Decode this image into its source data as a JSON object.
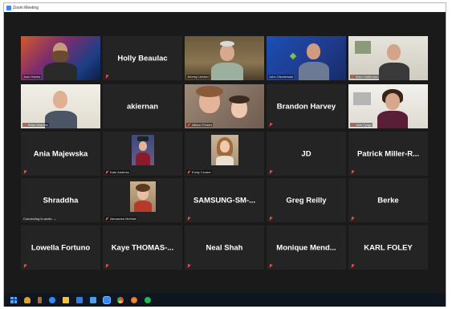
{
  "window": {
    "title": "Zoom Meeting"
  },
  "colors": {
    "tile_bg": "#242424",
    "active_border": "#c8d84a",
    "mute_red": "#e8534a",
    "taskbar": "#0f1620"
  },
  "participants": [
    {
      "name_label": "Josh Heehs",
      "display": "video",
      "muted": false
    },
    {
      "name_label": "Holly Beaulac",
      "display": "name",
      "muted": true
    },
    {
      "name_label": "Jeremy Uecker",
      "display": "video",
      "muted": false,
      "active_speaker": true
    },
    {
      "name_label": "John Olschewski",
      "display": "video",
      "muted": false
    },
    {
      "name_label": "Marc Halferman",
      "display": "video",
      "muted": true
    },
    {
      "name_label": "Brian Marples",
      "display": "video",
      "muted": true
    },
    {
      "name_label": "akiernan",
      "display": "name",
      "muted": false
    },
    {
      "name_label": "Allison Fricker",
      "display": "video",
      "muted": true
    },
    {
      "name_label": "Brandon Harvey",
      "display": "name",
      "muted": true
    },
    {
      "name_label": "Julie Fydge",
      "display": "video",
      "muted": true
    },
    {
      "name_label": "Ania Majewska",
      "display": "name",
      "muted": true
    },
    {
      "name_label": "Kate Anderss",
      "display": "photo",
      "muted": true
    },
    {
      "name_label": "Emily Crosier",
      "display": "photo",
      "muted": true
    },
    {
      "name_label": "JD",
      "display": "name",
      "muted": true
    },
    {
      "name_label": "Patrick Miller-R...",
      "display": "name",
      "muted": true
    },
    {
      "name_label": "Shraddha",
      "display": "name",
      "muted": false,
      "status": "Connecting to audio"
    },
    {
      "name_label": "Alexandra McHale",
      "display": "photo",
      "muted": true
    },
    {
      "name_label": "SAMSUNG-SM-...",
      "display": "name",
      "muted": true
    },
    {
      "name_label": "Greg Reilly",
      "display": "name",
      "muted": true
    },
    {
      "name_label": "Berke",
      "display": "name",
      "muted": true
    },
    {
      "name_label": "Lowella Fortuno",
      "display": "name",
      "muted": true
    },
    {
      "name_label": "Kaye THOMAS-...",
      "display": "name",
      "muted": true
    },
    {
      "name_label": "Neal Shah",
      "display": "name",
      "muted": true
    },
    {
      "name_label": "Monique Mend...",
      "display": "name",
      "muted": true
    },
    {
      "name_label": "KARL FOLEY",
      "display": "name",
      "muted": true
    }
  ],
  "taskbar_icons": [
    "windows-start-icon",
    "person-icon",
    "bottle-icon",
    "edge-icon",
    "file-explorer-icon",
    "mail-icon",
    "store-icon",
    "zoom-icon",
    "chrome-icon",
    "firefox-icon",
    "spotify-icon"
  ]
}
